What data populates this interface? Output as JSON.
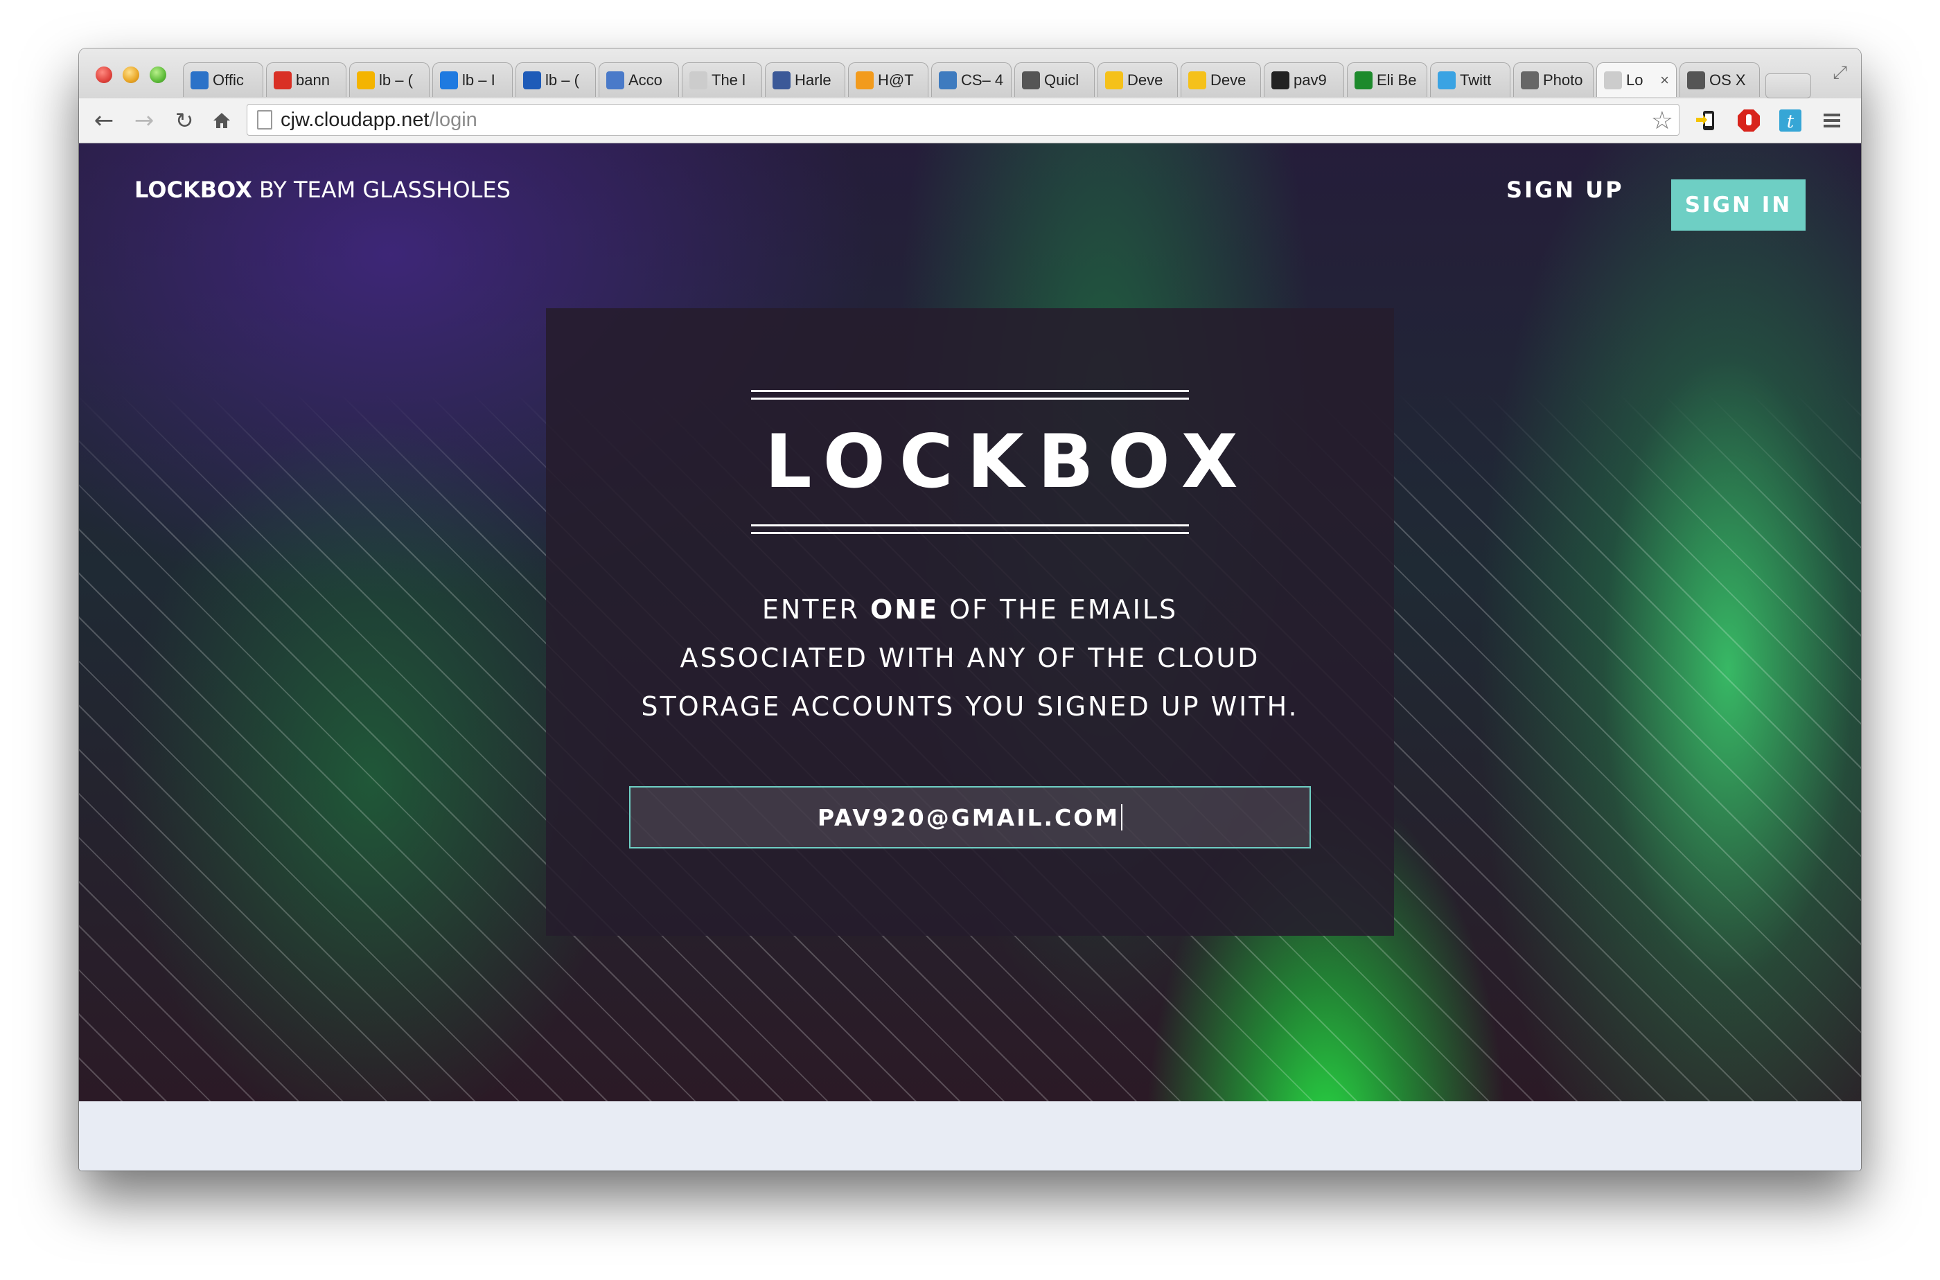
{
  "browser": {
    "tabs": [
      {
        "label": "Offic",
        "icon": "office-icon",
        "icon_color": "#2b72c8"
      },
      {
        "label": "bann",
        "icon": "gmail-icon",
        "icon_color": "#d93025"
      },
      {
        "label": "lb – (",
        "icon": "google-drive-icon",
        "icon_color": "#f4b400"
      },
      {
        "label": "lb – I",
        "icon": "dropbox-icon",
        "icon_color": "#1f7ae0"
      },
      {
        "label": "lb – (",
        "icon": "onedrive-icon",
        "icon_color": "#1e5bb8"
      },
      {
        "label": "Acco",
        "icon": "account-icon",
        "icon_color": "#4a7ac9"
      },
      {
        "label": "The l",
        "icon": "page-icon",
        "icon_color": "#cccccc"
      },
      {
        "label": "Harle",
        "icon": "facebook-icon",
        "icon_color": "#3b5998"
      },
      {
        "label": "H@T",
        "icon": "hat-icon",
        "icon_color": "#f29b1d"
      },
      {
        "label": "CS– 4",
        "icon": "piazza-icon",
        "icon_color": "#3e7bbf"
      },
      {
        "label": "Quicl",
        "icon": "phone-icon",
        "icon_color": "#555555"
      },
      {
        "label": "Deve",
        "icon": "developer-icon",
        "icon_color": "#f5c11a"
      },
      {
        "label": "Deve",
        "icon": "developer-icon",
        "icon_color": "#f5c11a"
      },
      {
        "label": "pav9",
        "icon": "github-icon",
        "icon_color": "#222222"
      },
      {
        "label": "Eli Be",
        "icon": "b-icon",
        "icon_color": "#1d8a2c"
      },
      {
        "label": "Twitt",
        "icon": "twitter-icon",
        "icon_color": "#3aa3e3"
      },
      {
        "label": "Photo",
        "icon": "brush-icon",
        "icon_color": "#666666"
      },
      {
        "label": "Lo",
        "icon": "page-icon",
        "icon_color": "#cccccc",
        "active": true
      },
      {
        "label": "OS X",
        "icon": "apple-icon",
        "icon_color": "#555555"
      }
    ],
    "url_host": "cjw.cloudapp.net",
    "url_path": "/login"
  },
  "nav": {
    "brand_bold": "LOCKBOX",
    "brand_rest": " BY TEAM GLASSHOLES",
    "signup_label": "SIGN UP",
    "signin_label": "SIGN IN"
  },
  "card": {
    "logo": "LOCKBOX",
    "instruction_prefix": "ENTER ",
    "instruction_bold": "ONE",
    "instruction_line1_rest": " OF THE EMAILS",
    "instruction_line2": "ASSOCIATED WITH ANY OF THE CLOUD",
    "instruction_line3": "STORAGE ACCOUNTS YOU SIGNED UP WITH.",
    "email_value": "PAV920@GMAIL.COM"
  },
  "colors": {
    "accent": "#6ecfc4",
    "card_bg": "#261c2c"
  }
}
